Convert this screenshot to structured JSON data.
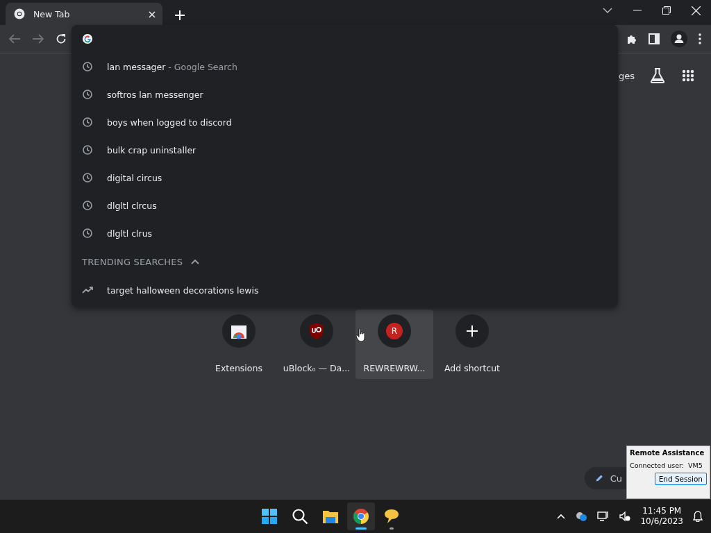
{
  "tabs": [
    {
      "title": "New Tab",
      "selected": true
    }
  ],
  "omnibox": {
    "suggestions": [
      {
        "kind": "history",
        "text": "lan messager",
        "detail": "- Google Search"
      },
      {
        "kind": "history",
        "text": "softros lan messenger"
      },
      {
        "kind": "history",
        "text": "boys when logged to discord"
      },
      {
        "kind": "history",
        "text": "bulk crap uninstaller"
      },
      {
        "kind": "history",
        "text": "digital circus"
      },
      {
        "kind": "history",
        "text": "dlgltl clrcus"
      },
      {
        "kind": "history",
        "text": "dlgltl clrus"
      }
    ],
    "trending": {
      "heading": "TRENDING SEARCHES",
      "expanded": true,
      "items": [
        {
          "kind": "trend",
          "text": "target halloween decorations lewis"
        }
      ]
    }
  },
  "new_tab": {
    "header_link": "ges",
    "shortcuts": [
      {
        "kind": "extensions",
        "title": "Extensions",
        "highlighted": false
      },
      {
        "kind": "shield",
        "title": "uBlock₀ — Da...",
        "highlighted": false
      },
      {
        "kind": "letter",
        "letter": "R",
        "title": "REWREWRW...",
        "highlighted": true
      },
      {
        "kind": "add",
        "title": "Add shortcut",
        "highlighted": false
      }
    ],
    "customize": "Cu"
  },
  "remote_assistance": {
    "title": "Remote Assistance",
    "connected": "Connected user:  VM5",
    "button": "End Session"
  },
  "taskbar": {
    "apps": [
      {
        "kind": "start",
        "active": false,
        "running": false
      },
      {
        "kind": "search",
        "active": false,
        "running": false
      },
      {
        "kind": "folder",
        "active": false,
        "running": false
      },
      {
        "kind": "browser",
        "active": true,
        "running": true
      },
      {
        "kind": "chat",
        "active": false,
        "running": true
      }
    ],
    "time": "11:45 PM",
    "date": "10/6/2023"
  }
}
